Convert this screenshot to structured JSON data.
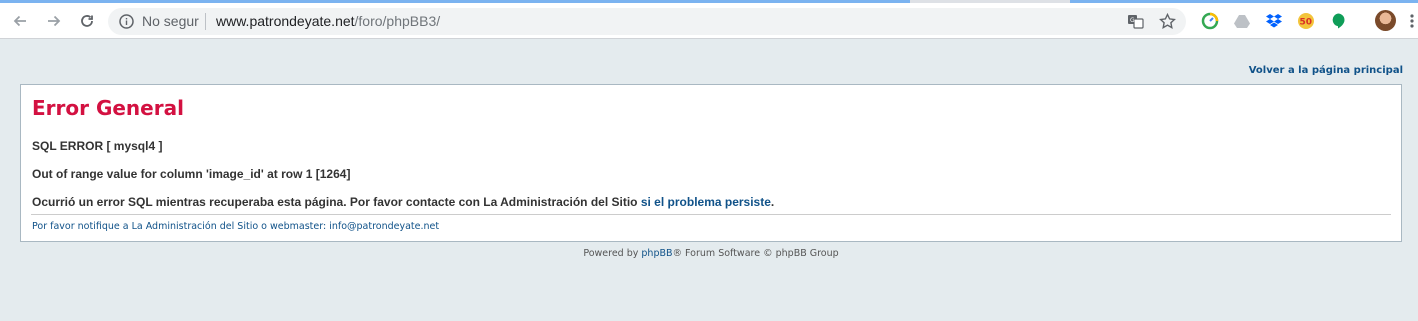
{
  "browser": {
    "security_label": "No segur",
    "url_host": "www.patrondeyate.net",
    "url_path": "/foro/phpBB3/",
    "icons": [
      "back-icon",
      "forward-icon",
      "reload-icon",
      "info-icon",
      "translate-icon",
      "star-icon",
      "speed-extension-icon",
      "drive-extension-icon",
      "dropbox-extension-icon",
      "50-extension-icon",
      "hangouts-extension-icon",
      "profile-avatar",
      "menu-icon"
    ],
    "colors": {
      "tab_accent": "#7bb3f0",
      "omnibox_bg": "#f1f3f4"
    }
  },
  "page": {
    "home_link": "Volver a la página principal",
    "error_title": "Error General",
    "sql_error": "SQL ERROR [ mysql4 ]",
    "sql_message": "Out of range value for column 'image_id' at row 1 [1264]",
    "occurred_text": "Ocurrió un error SQL mientras recuperaba esta página. Por favor contacte con La Administración del Sitio",
    "occurred_link": "si el problema persiste",
    "occurred_end": ".",
    "notify_text": "Por favor notifique a La Administración del Sitio o webmaster: info@patrondeyate.net",
    "powered_prefix": "Powered by",
    "powered_link": "phpBB",
    "powered_suffix": "® Forum Software © phpBB Group",
    "colors": {
      "background": "#e4ebee",
      "title": "#d31141",
      "link": "#105289"
    }
  }
}
